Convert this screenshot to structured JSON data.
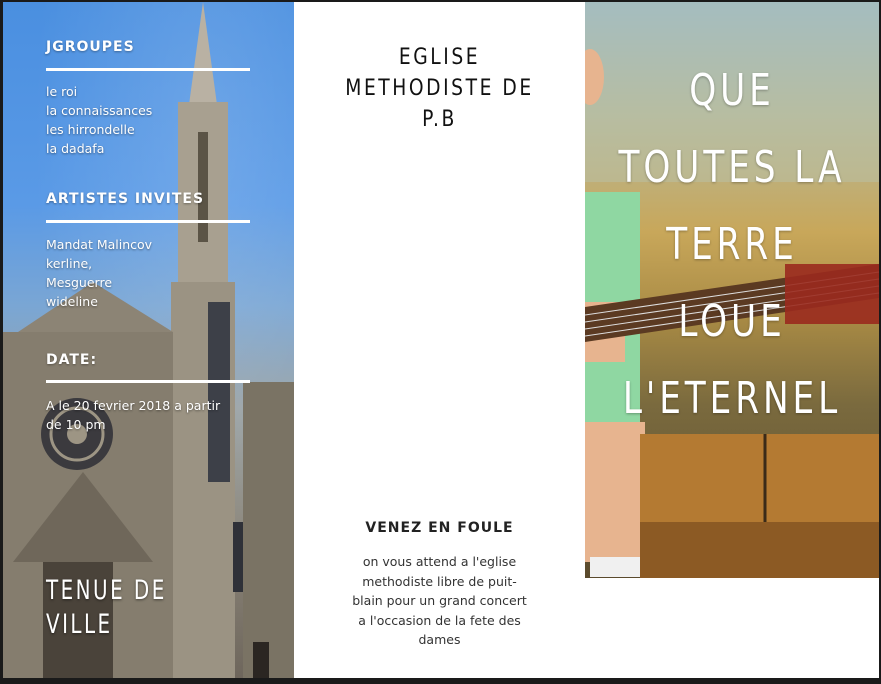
{
  "left_panel": {
    "section1": {
      "heading": "JGROUPES",
      "items": [
        "le roi",
        "la connaissances",
        "les hirrondelle",
        "la dadafa"
      ]
    },
    "section2": {
      "heading": "ARTISTES INVITES",
      "items": [
        "Mandat Malincov",
        "kerline,",
        "Mesguerre",
        "wideline"
      ]
    },
    "section3": {
      "heading": "DATE:",
      "items": [
        "A le 20 fevrier 2018 a partir",
        "de 10 pm"
      ]
    },
    "footer": {
      "line1": "TENUE DE",
      "line2": "VILLE"
    }
  },
  "middle_panel": {
    "title": [
      "EGLISE",
      "METHODISTE DE",
      "P.B"
    ],
    "venez_heading": "VENEZ EN FOULE",
    "venez_body": [
      "on vous attend a l'eglise",
      "methodiste libre de puit-",
      "blain pour un grand concert",
      "a l'occasion de la fete des",
      "dames"
    ]
  },
  "right_panel": {
    "title": [
      "QUE",
      "TOUTES LA",
      "TERRE",
      "LOUE",
      "L'ETERNEL"
    ]
  }
}
